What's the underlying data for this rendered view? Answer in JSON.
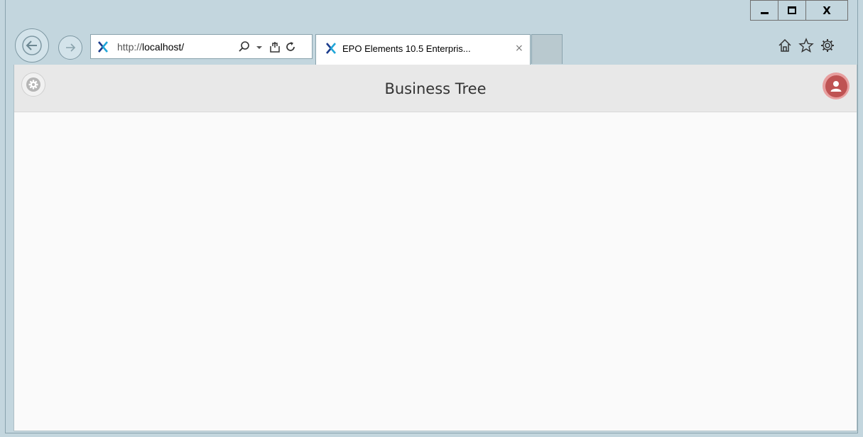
{
  "browser": {
    "address_url_prefix": "http://",
    "address_url_host": "localhost/",
    "tab_title": "EPO Elements 10.5 Enterpris...",
    "tab_close_glyph": "×",
    "window_close_glyph": "X"
  },
  "app": {
    "page_title": "Business Tree"
  },
  "colors": {
    "chrome_bg": "#c3d6de",
    "content_bg": "#fafafa",
    "header_bg": "#e8e8e8",
    "user_accent": "#bf5353"
  },
  "icons": {
    "back": "back-arrow-icon",
    "forward": "forward-arrow-icon",
    "favicon": "app-x-logo-icon",
    "search": "search-icon",
    "dropdown": "dropdown-icon",
    "compat": "compatibility-view-icon",
    "refresh": "refresh-icon",
    "home": "home-icon",
    "favorites": "star-icon",
    "tools": "gear-icon",
    "settings": "gear-icon",
    "user": "user-icon"
  }
}
